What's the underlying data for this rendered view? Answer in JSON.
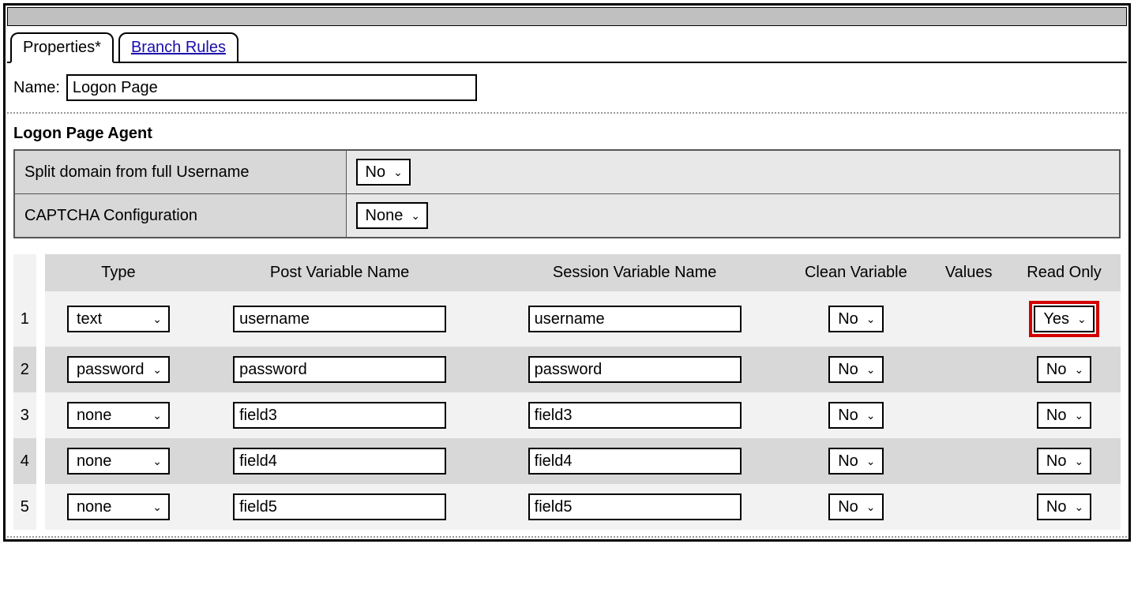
{
  "tabs": {
    "properties": "Properties*",
    "branch_rules": "Branch Rules"
  },
  "name_label": "Name:",
  "name_value": "Logon Page",
  "section_title": "Logon Page Agent",
  "settings": {
    "split_domain_label": "Split domain from full Username",
    "split_domain_value": "No",
    "captcha_label": "CAPTCHA Configuration",
    "captcha_value": "None"
  },
  "columns": {
    "type": "Type",
    "post": "Post Variable Name",
    "session": "Session Variable Name",
    "clean": "Clean Variable",
    "values": "Values",
    "readonly": "Read Only"
  },
  "rows": [
    {
      "n": "1",
      "type": "text",
      "post": "username",
      "session": "username",
      "clean": "No",
      "readonly": "Yes",
      "highlight": true
    },
    {
      "n": "2",
      "type": "password",
      "post": "password",
      "session": "password",
      "clean": "No",
      "readonly": "No",
      "highlight": false
    },
    {
      "n": "3",
      "type": "none",
      "post": "field3",
      "session": "field3",
      "clean": "No",
      "readonly": "No",
      "highlight": false
    },
    {
      "n": "4",
      "type": "none",
      "post": "field4",
      "session": "field4",
      "clean": "No",
      "readonly": "No",
      "highlight": false
    },
    {
      "n": "5",
      "type": "none",
      "post": "field5",
      "session": "field5",
      "clean": "No",
      "readonly": "No",
      "highlight": false
    }
  ]
}
